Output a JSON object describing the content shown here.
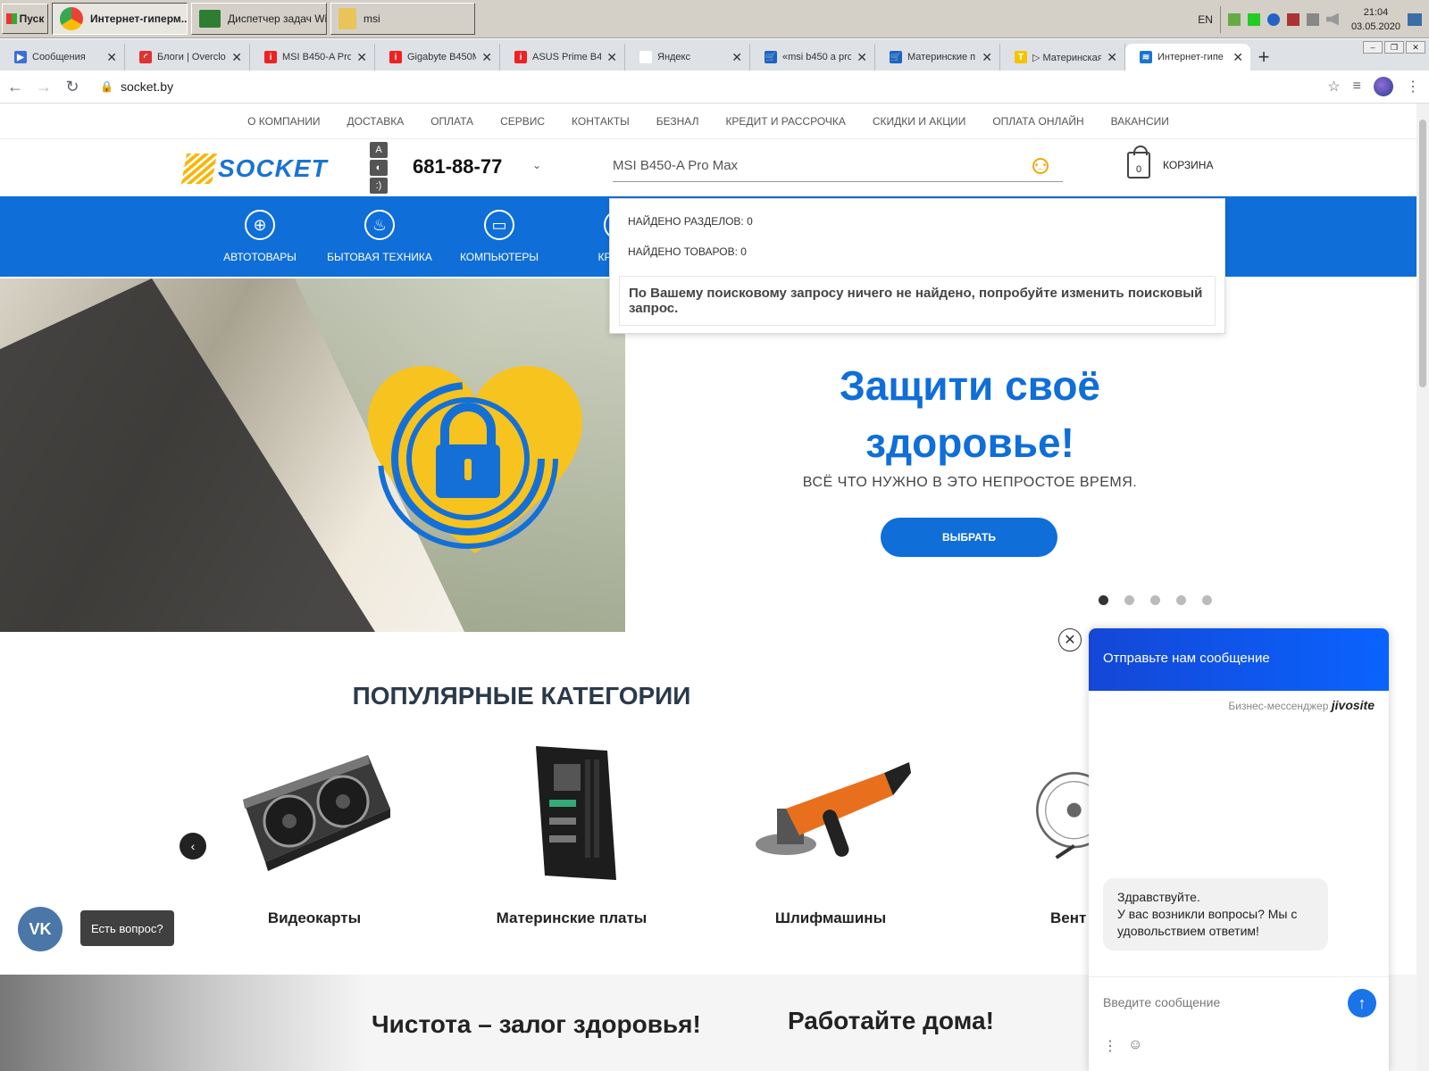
{
  "taskbar": {
    "start": "Пуск",
    "tasks": [
      "Интернет-гиперм...",
      "Диспетчер задач Wi...",
      "msi"
    ],
    "lang": "EN",
    "time": "21:04",
    "date": "03.05.2020"
  },
  "tabs": [
    {
      "title": "Сообщения",
      "color": "#3b6fd8",
      "glyph": "▶"
    },
    {
      "title": "Блоги | Overclo",
      "color": "#d33",
      "glyph": "◜"
    },
    {
      "title": "MSI B450-A Pro",
      "color": "#e22",
      "glyph": "i"
    },
    {
      "title": "Gigabyte B450M",
      "color": "#e22",
      "glyph": "i"
    },
    {
      "title": "ASUS Prime B4",
      "color": "#e22",
      "glyph": "i"
    },
    {
      "title": "Яндекс",
      "color": "#fff",
      "glyph": ""
    },
    {
      "title": "«msi b450 a pro",
      "color": "#1a63c7",
      "glyph": "🛒"
    },
    {
      "title": "Материнские п",
      "color": "#1a63c7",
      "glyph": "🛒"
    },
    {
      "title": "▷ Материнская",
      "color": "#f2c500",
      "glyph": "T"
    },
    {
      "title": "Интернет-гипе",
      "color": "#1a74d2",
      "glyph": "≋"
    }
  ],
  "url": "socket.by",
  "site": {
    "top_menu": [
      "О КОМПАНИИ",
      "ДОСТАВКА",
      "ОПЛАТА",
      "СЕРВИС",
      "КОНТАКТЫ",
      "БЕЗНАЛ",
      "КРЕДИТ И РАССРОЧКА",
      "СКИДКИ И АКЦИИ",
      "ОПЛАТА ОНЛАЙН",
      "ВАКАНСИИ"
    ],
    "logo": "SOCKET",
    "phone": "681-88-77",
    "search_value": "MSI B450-A Pro Max",
    "cart_count": "0",
    "cart_label": "КОРЗИНА",
    "categories": [
      {
        "label": "АВТОТОВАРЫ",
        "icon": "steering-wheel-icon",
        "glyph": "⊕"
      },
      {
        "label": "БЫТОВАЯ ТЕХНИКА",
        "icon": "kettle-icon",
        "glyph": "♨"
      },
      {
        "label": "КОМПЬЮТЕРЫ",
        "icon": "monitor-icon",
        "glyph": "▭"
      },
      {
        "label": "КРАСОТ",
        "icon": "hairdryer-icon",
        "glyph": "✦"
      }
    ],
    "dropdown": {
      "sections_found": "НАЙДЕНО РАЗДЕЛОВ: 0",
      "products_found": "НАЙДЕНО ТОВАРОВ: 0",
      "message": "По Вашему поисковому запросу ничего не найдено, попробуйте изменить поисковый запрос."
    },
    "hero": {
      "title": "Защити своё здоровье!",
      "subtitle": "ВСЁ ЧТО НУЖНО В ЭТО НЕПРОСТОЕ ВРЕМЯ.",
      "button": "ВЫБРАТЬ",
      "slides": 5,
      "active_slide": 1
    },
    "popular_title": "ПОПУЛЯРНЫЕ КАТЕГОРИИ",
    "popular": [
      "Видеокарты",
      "Материнские платы",
      "Шлифмашины",
      "Вент"
    ],
    "banners": [
      "Чистота – залог здоровья!",
      "Работайте дома!"
    ],
    "vk_label": "Есть вопрос?"
  },
  "jivo": {
    "header": "Отправьте нам сообщение",
    "brand_prefix": "Бизнес-мессенджер",
    "brand": "jivosite",
    "greeting_line1": "Здравствуйте.",
    "greeting_line2": "У вас возникли вопросы? Мы с удовольствием ответим!",
    "input_placeholder": "Введите сообщение"
  },
  "colors": {
    "brand_blue": "#0f6ed8",
    "logo_yellow": "#f7b500"
  }
}
